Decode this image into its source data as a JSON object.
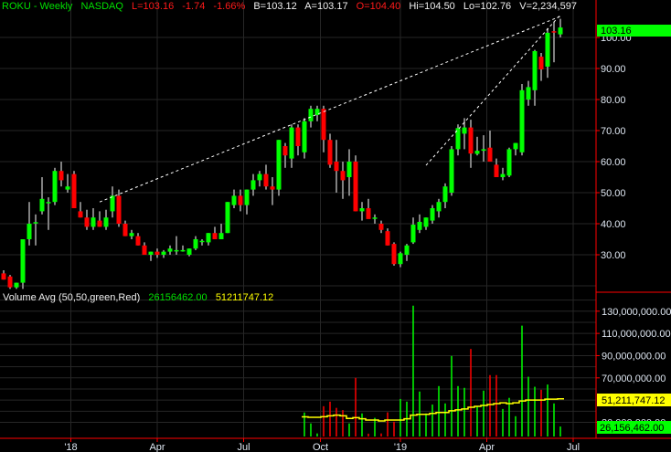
{
  "header": {
    "symbol": "ROKU - Weekly",
    "exchange": "NASDAQ",
    "last": "L=103.16",
    "change": "-1.74",
    "change_pct": "-1.66%",
    "bid": "B=103.12",
    "ask": "A=103.17",
    "open": "O=104.40",
    "high": "Hi=104.50",
    "low": "Lo=102.76",
    "volume": "V=2,234,597"
  },
  "volume_header": {
    "label": "Volume Avg (50,50,green,Red)",
    "volume_value": "26156462.00",
    "avg_value": "51211747.12"
  },
  "colors": {
    "up": "#00ff00",
    "down": "#ff0000",
    "avg": "#ffff00",
    "axis_line": "#ff0000"
  },
  "chart_data": [
    {
      "type": "candlestick",
      "title": "ROKU - Weekly NASDAQ",
      "price_ticks": [
        "30.00",
        "40.00",
        "50.00",
        "60.00",
        "70.00",
        "80.00",
        "90.00",
        "100.00"
      ],
      "price_tick_values": [
        30,
        40,
        50,
        60,
        70,
        80,
        90,
        100
      ],
      "last_price_label": "103.16",
      "x_labels": [
        "'18",
        "Apr",
        "Jul",
        "Oct",
        "'19",
        "Apr",
        "Jul"
      ],
      "x_label_week_index": [
        10.5,
        24,
        37.5,
        49.5,
        62,
        75.5,
        89
      ],
      "ohlc": [
        [
          24,
          25,
          22,
          22
        ],
        [
          23,
          23.5,
          19,
          19.5
        ],
        [
          19.5,
          21,
          19,
          21
        ],
        [
          21,
          35,
          19,
          35
        ],
        [
          35,
          47,
          33,
          40
        ],
        [
          40.5,
          43,
          33,
          40.5
        ],
        [
          44,
          55,
          43,
          48
        ],
        [
          47,
          48.5,
          38,
          47
        ],
        [
          47,
          58,
          46,
          57
        ],
        [
          57,
          60,
          52,
          54
        ],
        [
          51,
          56,
          50,
          52
        ],
        [
          56,
          57,
          45,
          45
        ],
        [
          44,
          47,
          42,
          42
        ],
        [
          42,
          44.5,
          38,
          39
        ],
        [
          39,
          45,
          38,
          42
        ],
        [
          41,
          44,
          39,
          39
        ],
        [
          39,
          44.5,
          38,
          42
        ],
        [
          44,
          52,
          42,
          49
        ],
        [
          49,
          51,
          39,
          40
        ],
        [
          40,
          41,
          36,
          36
        ],
        [
          36,
          38,
          35,
          37
        ],
        [
          36,
          37,
          33,
          33
        ],
        [
          33,
          34,
          30,
          30
        ],
        [
          30,
          31,
          28,
          31
        ],
        [
          31,
          32,
          29,
          30
        ],
        [
          30,
          31.5,
          29,
          31
        ],
        [
          31,
          33,
          30,
          32
        ],
        [
          31.5,
          36,
          30,
          31.5
        ],
        [
          31.5,
          33,
          31,
          31.5
        ],
        [
          30,
          32,
          29.5,
          32
        ],
        [
          32,
          36,
          31.5,
          35
        ],
        [
          34.5,
          35,
          33,
          34.5
        ],
        [
          34,
          37,
          33,
          37
        ],
        [
          37,
          39,
          35,
          35
        ],
        [
          35,
          40,
          35,
          37
        ],
        [
          37,
          47,
          37,
          47
        ],
        [
          46,
          51,
          45,
          49
        ],
        [
          49,
          51,
          44,
          46
        ],
        [
          46,
          51,
          43,
          51
        ],
        [
          51,
          56,
          49,
          54
        ],
        [
          54,
          57,
          52,
          56
        ],
        [
          56,
          59,
          51,
          52
        ],
        [
          52,
          55,
          46,
          51
        ],
        [
          51,
          67,
          49,
          67
        ],
        [
          65,
          66,
          58,
          62
        ],
        [
          61,
          72,
          58,
          71
        ],
        [
          71,
          72,
          62,
          65
        ],
        [
          63,
          74,
          61,
          73
        ],
        [
          73,
          78,
          71,
          77
        ],
        [
          75,
          78,
          73,
          77
        ],
        [
          77,
          78,
          63,
          67
        ],
        [
          67,
          69,
          58,
          59
        ],
        [
          60,
          67,
          50,
          57
        ],
        [
          57,
          60,
          48,
          54
        ],
        [
          55,
          64,
          49,
          60
        ],
        [
          60,
          62,
          44,
          44
        ],
        [
          44,
          47,
          41,
          45
        ],
        [
          45,
          48,
          42,
          41.5
        ],
        [
          42,
          43,
          40,
          42
        ],
        [
          40,
          41,
          37,
          38
        ],
        [
          37.6,
          38.5,
          33,
          33
        ],
        [
          33.5,
          34,
          26.5,
          27
        ],
        [
          27,
          31,
          26,
          30.5
        ],
        [
          30,
          33.5,
          28,
          33
        ],
        [
          34,
          42,
          33.5,
          39.7
        ],
        [
          38,
          43,
          37,
          40.6
        ],
        [
          39,
          42,
          38,
          42
        ],
        [
          41,
          46,
          40,
          45
        ],
        [
          44,
          48,
          42,
          47
        ],
        [
          47,
          53,
          45,
          52
        ],
        [
          50,
          65,
          49,
          64
        ],
        [
          64,
          72,
          62,
          70.8
        ],
        [
          69,
          74,
          64,
          71
        ],
        [
          71,
          73.5,
          58,
          62.6
        ],
        [
          62.5,
          68,
          62,
          63.5
        ],
        [
          63.5,
          68.5,
          60,
          64
        ],
        [
          64.5,
          70,
          61,
          60
        ],
        [
          59,
          61,
          56,
          55
        ],
        [
          55,
          58,
          54,
          56
        ],
        [
          55.5,
          64.5,
          55,
          64
        ],
        [
          64,
          66,
          62,
          66
        ],
        [
          63,
          85,
          62,
          83
        ],
        [
          80,
          86,
          78,
          84
        ],
        [
          83,
          96,
          78,
          95.6
        ],
        [
          93.8,
          95,
          86,
          89.7
        ],
        [
          90.6,
          103,
          87,
          101.5
        ],
        [
          102,
          105,
          92,
          101.8
        ],
        [
          101,
          106,
          100,
          103.2
        ]
      ],
      "trendlines": [
        {
          "from": {
            "week": 15,
            "price": 47
          },
          "to": {
            "week": 87,
            "price": 106.8
          }
        },
        {
          "from": {
            "week": 66,
            "price": 58.8
          },
          "to": {
            "week": 87,
            "price": 107.3
          }
        }
      ],
      "ylim": [
        18,
        112
      ]
    },
    {
      "type": "bar",
      "title": "Volume Avg (50,50,green,Red)",
      "volume_ticks": [
        "130,000,000.00",
        "110,000,000.00",
        "90,000,000.00",
        "70,000,000.00",
        "30,000,000.00"
      ],
      "volume_tick_values": [
        130,
        110,
        90,
        70,
        30
      ],
      "units": "millions",
      "first_week_index": 47,
      "volume": [
        38.8,
        29,
        20,
        44.5,
        48.6,
        43,
        41,
        29,
        70,
        38,
        19.8,
        34,
        20,
        39,
        30.5,
        51,
        48.6,
        135,
        57.7,
        38,
        46,
        62.6,
        47,
        89.7,
        62.6,
        61,
        96,
        44.5,
        58.5,
        72.5,
        72.5,
        42,
        52,
        35.5,
        117,
        71,
        62,
        59.3,
        64,
        47,
        26.2
      ],
      "volume_color": [
        "up",
        "up",
        "up",
        "down",
        "down",
        "down",
        "down",
        "up",
        "down",
        "up",
        "down",
        "up",
        "down",
        "down",
        "down",
        "up",
        "up",
        "up",
        "up",
        "up",
        "up",
        "up",
        "up",
        "up",
        "up",
        "up",
        "down",
        "up",
        "up",
        "down",
        "down",
        "up",
        "up",
        "up",
        "up",
        "up",
        "up",
        "down",
        "up",
        "up",
        "up"
      ],
      "avg": [
        34.9,
        34.5,
        34.5,
        35,
        35.8,
        36.5,
        35.8,
        33.5,
        34.2,
        33.2,
        32,
        32,
        31.2,
        32,
        32,
        32,
        33.2,
        36.5,
        37.2,
        37.2,
        38,
        38.8,
        38.8,
        40.4,
        41.2,
        42,
        43.6,
        44.4,
        45.2,
        46,
        46.8,
        47.6,
        46.8,
        47.6,
        49.2,
        50,
        50,
        50,
        50.8,
        50.8,
        51.2
      ],
      "volume_label": "26,156,462.00",
      "avg_label": "51,211,747.12",
      "ylim": [
        0,
        150
      ]
    }
  ]
}
